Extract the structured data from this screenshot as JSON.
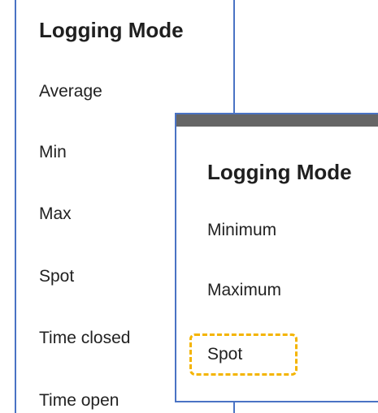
{
  "back_menu": {
    "title": "Logging Mode",
    "items": [
      {
        "label": "Average"
      },
      {
        "label": "Min"
      },
      {
        "label": "Max"
      },
      {
        "label": "Spot"
      },
      {
        "label": "Time closed"
      },
      {
        "label": "Time open"
      }
    ]
  },
  "front_menu": {
    "title": "Logging Mode",
    "items": [
      {
        "label": "Minimum"
      },
      {
        "label": "Maximum"
      },
      {
        "label": "Spot",
        "highlighted": true
      }
    ]
  },
  "colors": {
    "panel_border": "#4a73c4",
    "front_topbar": "#666666",
    "highlight": "#f4b400"
  }
}
